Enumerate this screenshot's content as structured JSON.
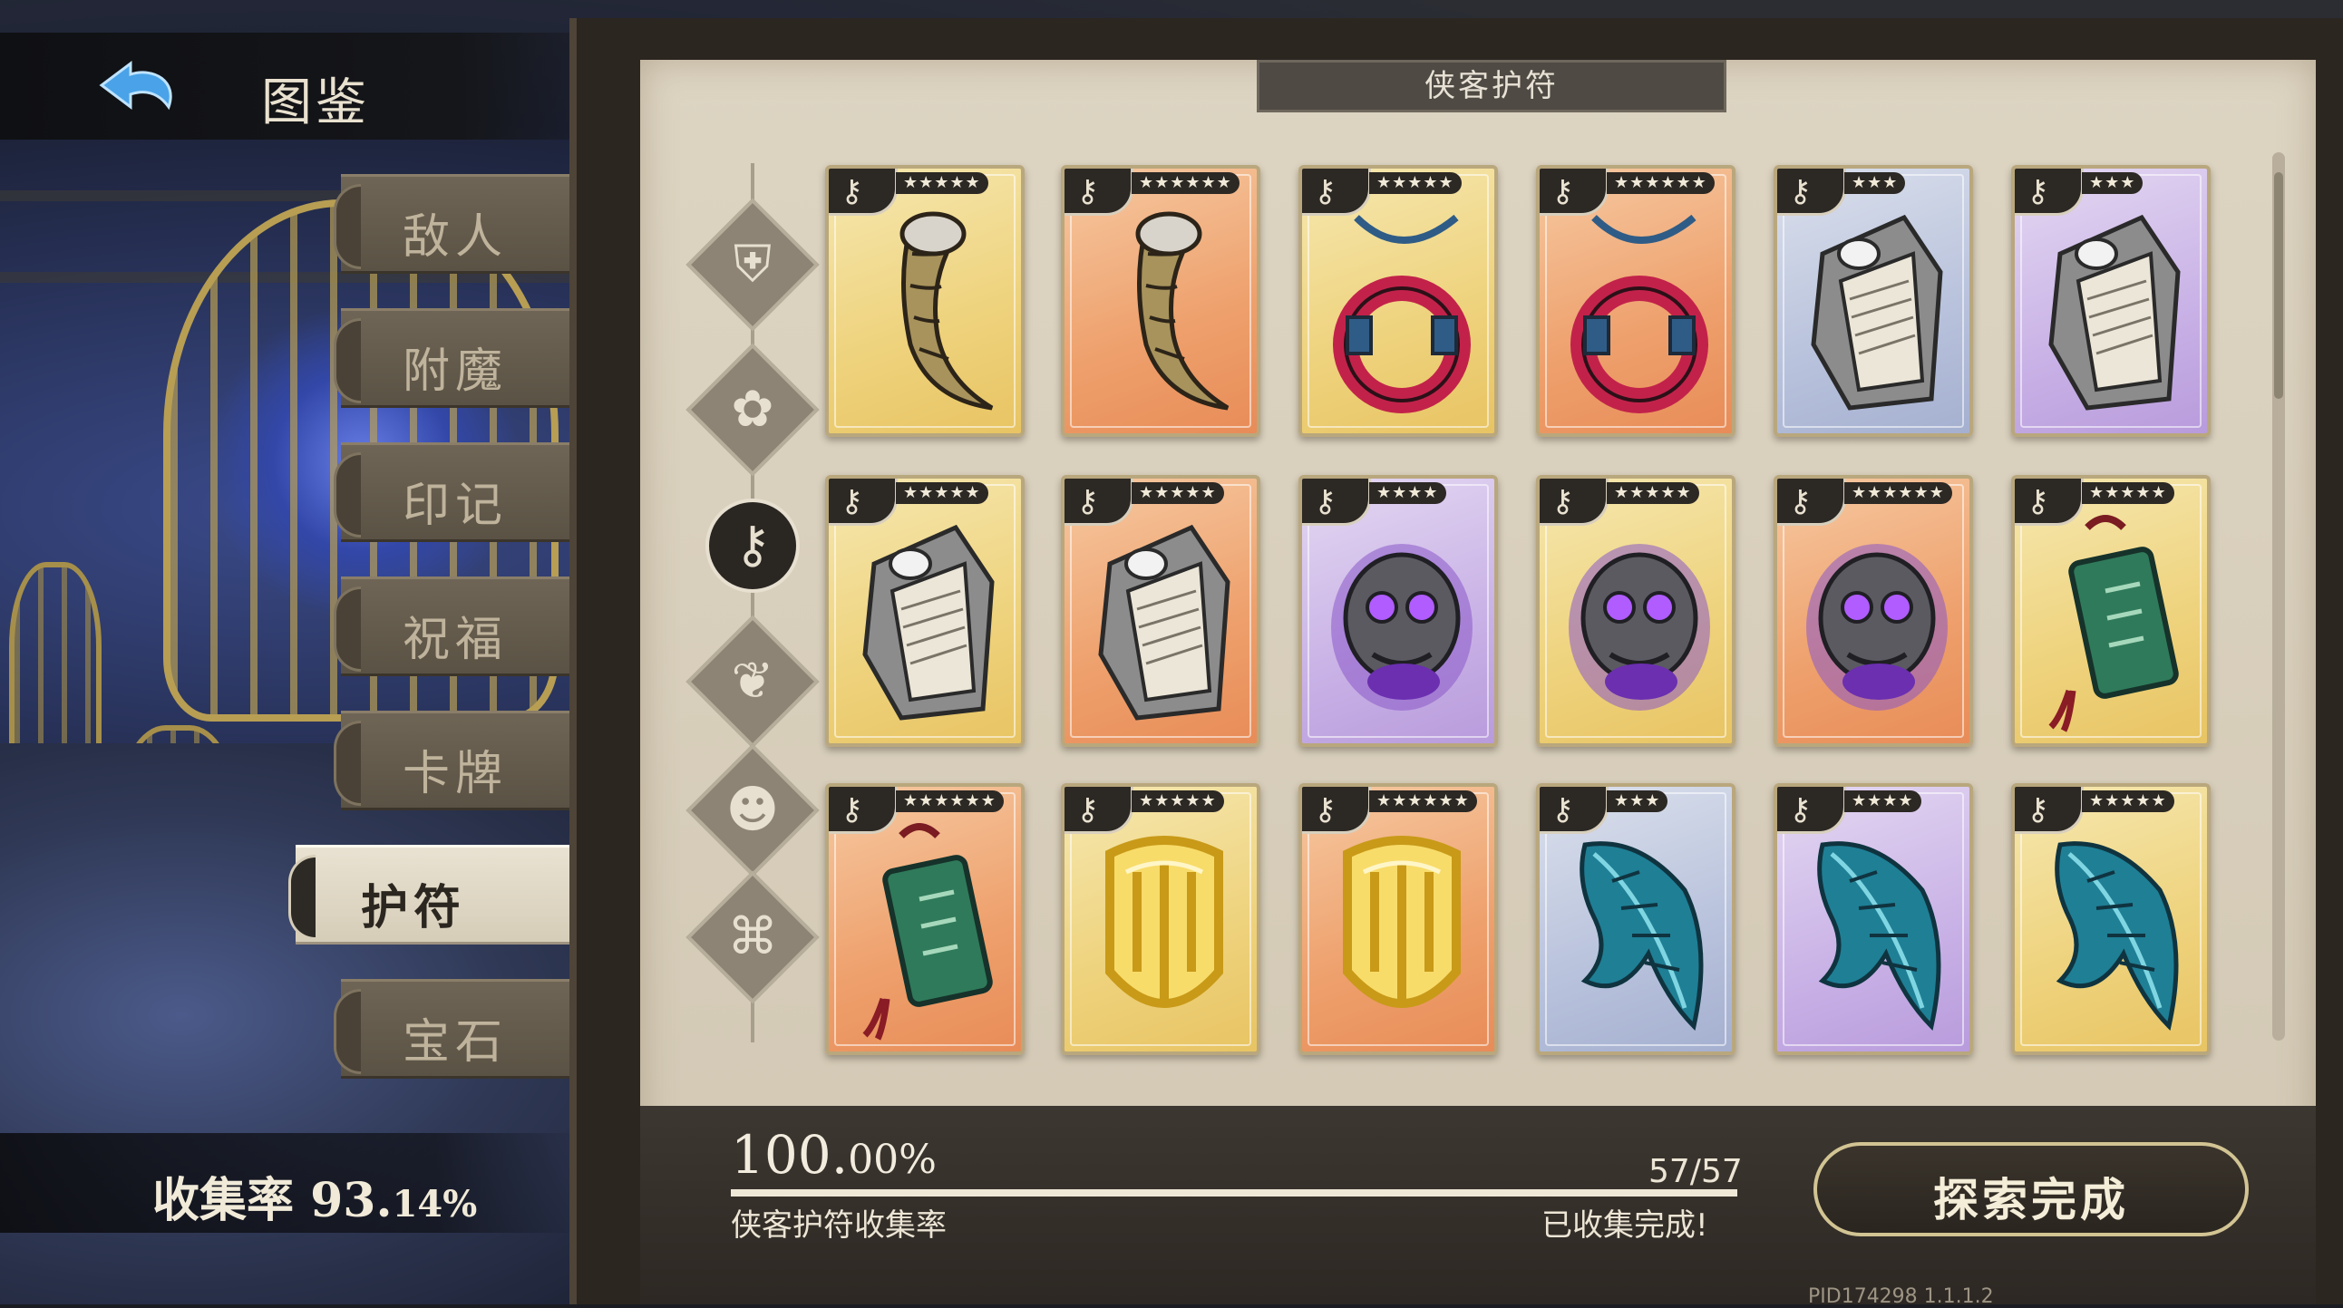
{
  "header": {
    "title": "图鉴",
    "back_icon": "back-arrow-icon"
  },
  "menu": [
    {
      "label": "敌人",
      "active": false
    },
    {
      "label": "附魔",
      "active": false
    },
    {
      "label": "印记",
      "active": false
    },
    {
      "label": "祝福",
      "active": false
    },
    {
      "label": "卡牌",
      "active": false
    },
    {
      "label": "护符",
      "active": true
    },
    {
      "label": "宝石",
      "active": false
    }
  ],
  "collection": {
    "label": "收集率",
    "value": "93.",
    "decimal": "14%"
  },
  "panel": {
    "title": "侠客护符"
  },
  "categories": [
    {
      "icon": "shield-crest-icon"
    },
    {
      "icon": "flower-crest-icon"
    },
    {
      "icon": "key-crest-icon",
      "active": true
    },
    {
      "icon": "swirl-crest-icon"
    },
    {
      "icon": "mask-crest-icon"
    },
    {
      "icon": "knot-crest-icon"
    }
  ],
  "cards": [
    {
      "item": "horn",
      "bg": "gold",
      "stars": "★★★★★"
    },
    {
      "item": "horn",
      "bg": "orange",
      "stars": "★★★★★★"
    },
    {
      "item": "red-ring",
      "bg": "gold",
      "stars": "★★★★★"
    },
    {
      "item": "red-ring",
      "bg": "orange",
      "stars": "★★★★★★"
    },
    {
      "item": "letter-box",
      "bg": "blue",
      "stars": "★★★"
    },
    {
      "item": "letter-box",
      "bg": "purple",
      "stars": "★★★"
    },
    {
      "item": "letter-box",
      "bg": "gold",
      "stars": "★★★★★"
    },
    {
      "item": "letter-box",
      "bg": "orange",
      "stars": "★★★★★"
    },
    {
      "item": "skull-orb",
      "bg": "purple",
      "stars": "★★★★"
    },
    {
      "item": "skull-orb",
      "bg": "gold",
      "stars": "★★★★★"
    },
    {
      "item": "skull-orb",
      "bg": "orange",
      "stars": "★★★★★★"
    },
    {
      "item": "jade-tablet",
      "bg": "gold",
      "stars": "★★★★★"
    },
    {
      "item": "jade-tablet",
      "bg": "orange",
      "stars": "★★★★★★"
    },
    {
      "item": "gold-crest",
      "bg": "gold",
      "stars": "★★★★★"
    },
    {
      "item": "gold-crest",
      "bg": "orange",
      "stars": "★★★★★★"
    },
    {
      "item": "teal-feather",
      "bg": "blue",
      "stars": "★★★"
    },
    {
      "item": "teal-feather",
      "bg": "purple",
      "stars": "★★★★"
    },
    {
      "item": "teal-feather",
      "bg": "gold",
      "stars": "★★★★★"
    }
  ],
  "progress": {
    "percent_int": "100.",
    "percent_dec": "00%",
    "fraction": 1.0,
    "label": "侠客护符收集率",
    "count": "57/57",
    "status": "已收集完成!"
  },
  "explore_button": {
    "label": "探索完成"
  },
  "pid": "PID174298 1.1.1.2"
}
